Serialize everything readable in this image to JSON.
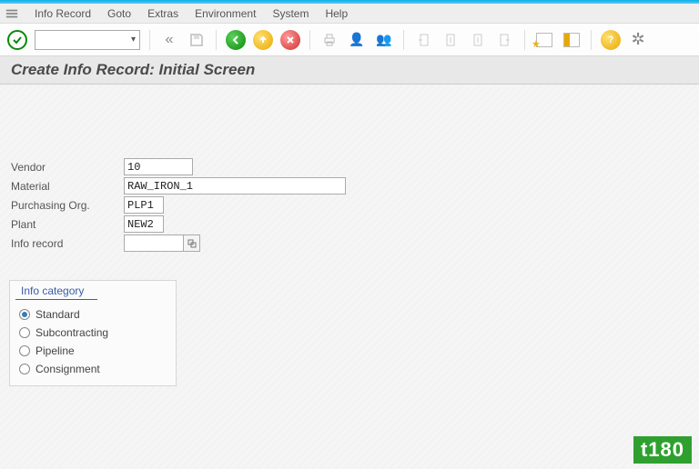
{
  "menu": {
    "items": [
      "Info Record",
      "Goto",
      "Extras",
      "Environment",
      "System",
      "Help"
    ],
    "underline_idx": [
      0,
      0,
      5,
      2,
      1,
      0
    ]
  },
  "title": "Create Info Record: Initial Screen",
  "form": {
    "vendor": {
      "label": "Vendor",
      "value": "10"
    },
    "material": {
      "label": "Material",
      "value": "RAW_IRON_1"
    },
    "purch_org": {
      "label": "Purchasing Org.",
      "value": "PLP1"
    },
    "plant": {
      "label": "Plant",
      "value": "NEW2"
    },
    "info_record": {
      "label": "Info record",
      "value": ""
    }
  },
  "info_category": {
    "title": "Info category",
    "options": [
      "Standard",
      "Subcontracting",
      "Pipeline",
      "Consignment"
    ],
    "selected": 0
  },
  "watermark": "t180"
}
